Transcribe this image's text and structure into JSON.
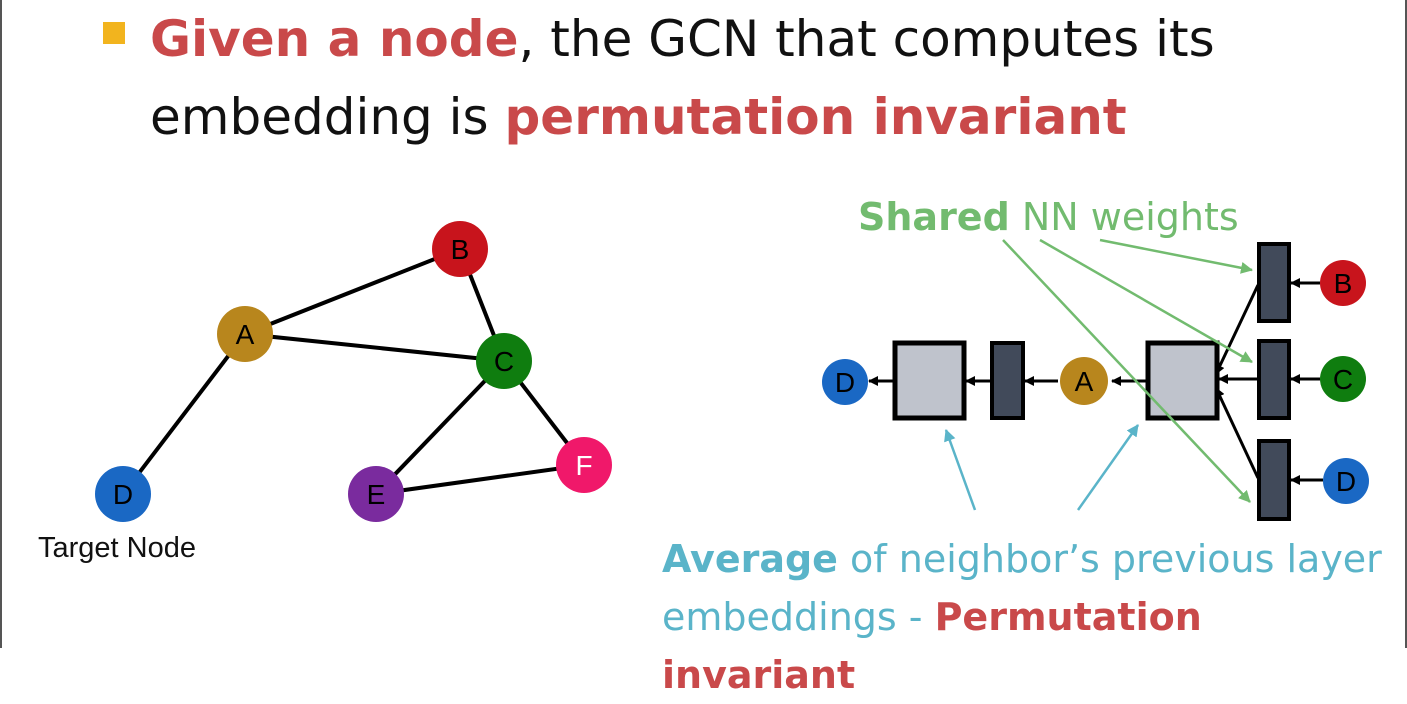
{
  "title": {
    "highlight1": "Given a node",
    "mid": ", the GCN that computes its embedding is ",
    "highlight2": "permutation invariant"
  },
  "left_graph": {
    "nodes": [
      {
        "id": "A",
        "color": "#b8861d"
      },
      {
        "id": "B",
        "color": "#c8141c"
      },
      {
        "id": "C",
        "color": "#0f7d0f"
      },
      {
        "id": "D",
        "color": "#1a68c4"
      },
      {
        "id": "E",
        "color": "#7a2b9e"
      },
      {
        "id": "F",
        "color": "#f0186a"
      }
    ],
    "edges": [
      [
        "A",
        "B"
      ],
      [
        "A",
        "C"
      ],
      [
        "B",
        "C"
      ],
      [
        "A",
        "D"
      ],
      [
        "C",
        "E"
      ],
      [
        "C",
        "F"
      ],
      [
        "E",
        "F"
      ]
    ],
    "target_label": "Target Node"
  },
  "right_diagram": {
    "shared_bold": "Shared",
    "shared_rest": " NN weights",
    "avg_bold": "Average",
    "avg_rest": " of neighbor’s previous layer embeddings - ",
    "avg_red": "Permutation invariant",
    "nodes": [
      "D",
      "A",
      "B",
      "C",
      "D"
    ],
    "colors": {
      "box_fill": "#bfc3cc",
      "bar_fill": "#414a5a",
      "shared_arrow": "#72bb6f",
      "avg_arrow": "#5ab4c9"
    }
  },
  "colors": {
    "accent": "#c9494a",
    "bullet": "#f2b41e"
  }
}
